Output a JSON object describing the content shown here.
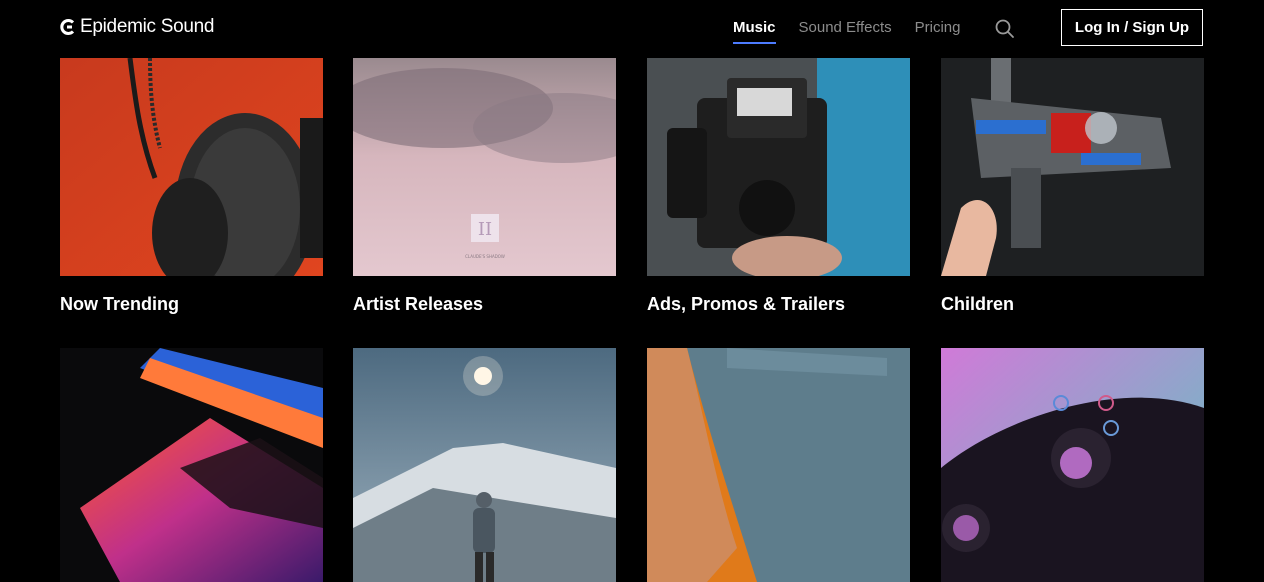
{
  "header": {
    "logo_text": "Epidemic Sound",
    "nav": [
      {
        "label": "Music",
        "active": true
      },
      {
        "label": "Sound Effects",
        "active": false
      },
      {
        "label": "Pricing",
        "active": false
      }
    ],
    "login_label": "Log In / Sign Up",
    "accent_color": "#4d7cff"
  },
  "categories": [
    {
      "label": "Now Trending",
      "image": "headphones-on-red"
    },
    {
      "label": "Artist Releases",
      "image": "pink-cloud-album-cover"
    },
    {
      "label": "Ads, Promos & Trailers",
      "image": "video-camera"
    },
    {
      "label": "Children",
      "image": "toy-spaceship"
    },
    {
      "label": "",
      "image": "laptop-neon"
    },
    {
      "label": "",
      "image": "mountain-hiker"
    },
    {
      "label": "",
      "image": "person-pocket"
    },
    {
      "label": "",
      "image": "game-controller"
    }
  ],
  "album_cover_text": "CLAUDE'S SHADOW"
}
